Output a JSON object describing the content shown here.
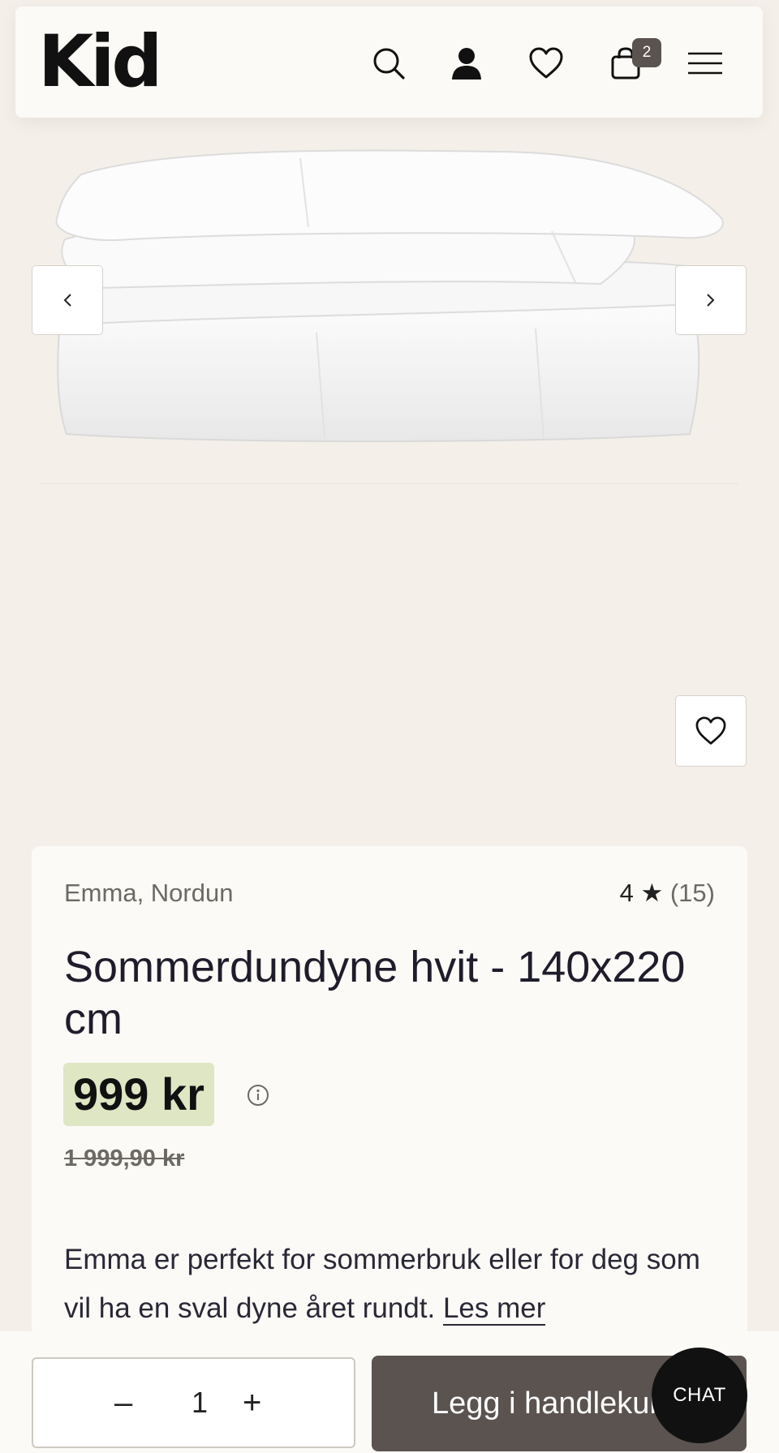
{
  "header": {
    "logo": "Kid",
    "cart_count": "2",
    "icons": [
      "search-icon",
      "user-icon",
      "heart-icon",
      "bag-icon",
      "menu-icon"
    ]
  },
  "gallery": {
    "image_alt": "white duvet folded",
    "prev_icon": "chevron-left-icon",
    "next_icon": "chevron-right-icon",
    "wishlist_icon": "heart-icon"
  },
  "product": {
    "brand": "Emma, Nordun",
    "rating": "4",
    "rating_star": "★",
    "review_count": "(15)",
    "title": "Sommerdundyne hvit - 140x220 cm",
    "price": "999 kr",
    "old_price": "1 999,90 kr",
    "description": "Emma er perfekt for sommerbruk eller for deg som vil ha en sval dyne året rundt.",
    "read_more": "Les mer"
  },
  "purchase": {
    "minus": "–",
    "quantity": "1",
    "plus": "+",
    "add_to_cart": "Legg i handlekurv",
    "chat": "CHAT"
  },
  "colors": {
    "background": "#f4f0e9",
    "card": "#fbfaf6",
    "price_highlight": "#dfe6c4",
    "button": "#5a5350"
  }
}
